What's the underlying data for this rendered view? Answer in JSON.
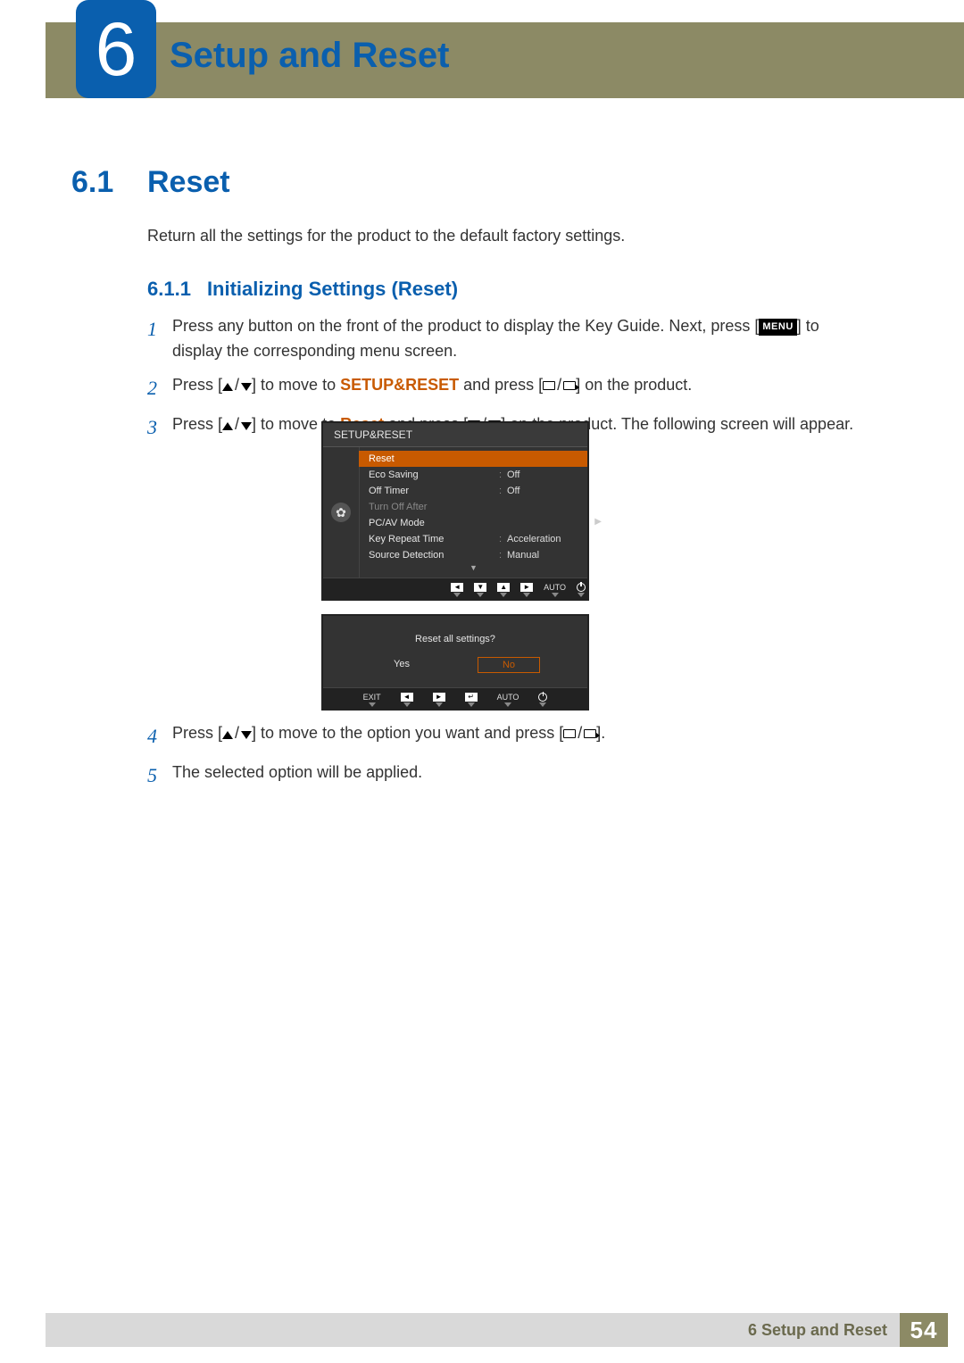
{
  "chapter": {
    "number": "6",
    "title": "Setup and Reset"
  },
  "section": {
    "number": "6.1",
    "title": "Reset"
  },
  "intro": "Return all the settings for the product to the default factory settings.",
  "subsection": {
    "number": "6.1.1",
    "title": "Initializing Settings (Reset)"
  },
  "steps": {
    "s1_a": "Press any button on the front of the product to display the Key Guide. Next, press [",
    "s1_menu": "MENU",
    "s1_b": "] to display the corresponding menu screen.",
    "s2_a": "Press [",
    "s2_b": "] to move to ",
    "s2_bold": "SETUP&RESET",
    "s2_c": " and press [",
    "s2_d": "] on the product.",
    "s3_a": "Press [",
    "s3_b": "] to move to ",
    "s3_bold": "Reset",
    "s3_c": " and press [",
    "s3_d": "] on the product. The following screen will appear.",
    "s4_a": "Press [",
    "s4_b": "] to move to the option you want and press [",
    "s4_c": "].",
    "s5": "The selected option will be applied.",
    "n1": "1",
    "n2": "2",
    "n3": "3",
    "n4": "4",
    "n5": "5"
  },
  "osd1": {
    "title": "SETUP&RESET",
    "items": [
      {
        "label": "Reset",
        "value": "",
        "highlight": true
      },
      {
        "label": "Eco Saving",
        "value": "Off"
      },
      {
        "label": "Off Timer",
        "value": "Off"
      },
      {
        "label": "Turn Off After",
        "value": ""
      },
      {
        "label": "PC/AV Mode",
        "value": ""
      },
      {
        "label": "Key Repeat Time",
        "value": "Acceleration"
      },
      {
        "label": "Source Detection",
        "value": "Manual"
      }
    ],
    "footer_auto": "AUTO"
  },
  "osd2": {
    "question": "Reset all settings?",
    "yes": "Yes",
    "no": "No",
    "exit": "EXIT",
    "auto": "AUTO"
  },
  "footer": {
    "label": "6 Setup and Reset",
    "page": "54"
  }
}
